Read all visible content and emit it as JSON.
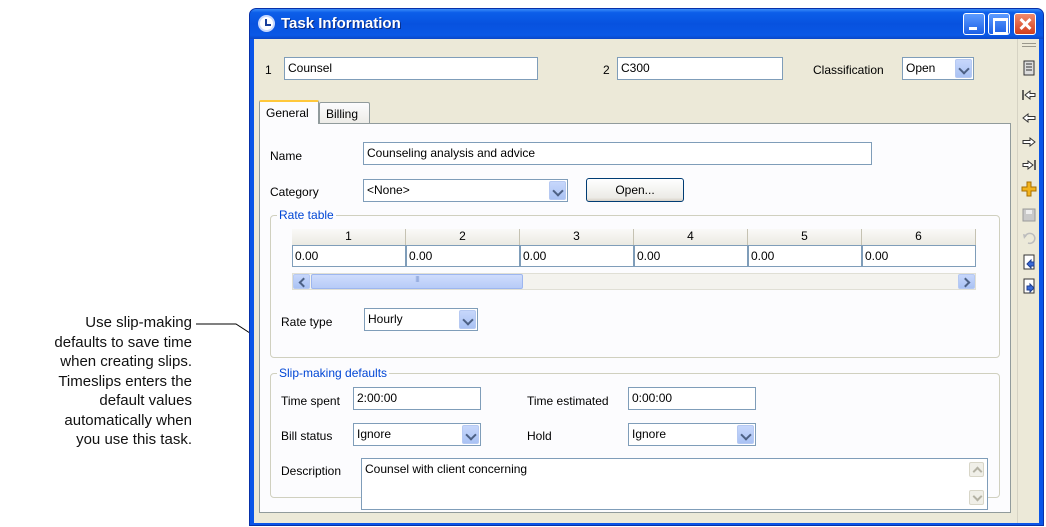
{
  "callout": {
    "lines": [
      "Use slip-making",
      "defaults to save time",
      "when creating slips.",
      "Timeslips enters the",
      "default values",
      "automatically when",
      "you use this task."
    ]
  },
  "window": {
    "title": "Task Information"
  },
  "header": {
    "field1_label": "1",
    "field1_value": "Counsel",
    "field2_label": "2",
    "field2_value": "C300",
    "classification_label": "Classification",
    "classification_value": "Open"
  },
  "tabs": [
    {
      "label": "General",
      "active": true
    },
    {
      "label": "Billing",
      "active": false
    }
  ],
  "general": {
    "name_label": "Name",
    "name_value": "Counseling analysis and advice",
    "category_label": "Category",
    "category_value": "<None>",
    "open_button": "Open..."
  },
  "rate_table": {
    "title": "Rate table",
    "columns": [
      "1",
      "2",
      "3",
      "4",
      "5",
      "6"
    ],
    "values": [
      "0.00",
      "0.00",
      "0.00",
      "0.00",
      "0.00",
      "0.00"
    ],
    "rate_type_label": "Rate type",
    "rate_type_value": "Hourly"
  },
  "slip_defaults": {
    "title": "Slip-making defaults",
    "time_spent_label": "Time spent",
    "time_spent_value": "2:00:00",
    "time_estimated_label": "Time estimated",
    "time_estimated_value": "0:00:00",
    "bill_status_label": "Bill status",
    "bill_status_value": "Ignore",
    "hold_label": "Hold",
    "hold_value": "Ignore",
    "description_label": "Description",
    "description_value": "Counsel with client concerning"
  },
  "toolbar": {
    "icons": [
      "notes-icon",
      "first-record-icon",
      "previous-record-icon",
      "next-record-icon",
      "last-record-icon",
      "new-record-icon",
      "save-icon",
      "undo-icon",
      "export-icon",
      "import-icon"
    ]
  },
  "colors": {
    "titlebar": "#0752df",
    "client_bg": "#ece9d8",
    "group_title": "#0046d5",
    "tab_highlight": "#ffc83c"
  }
}
